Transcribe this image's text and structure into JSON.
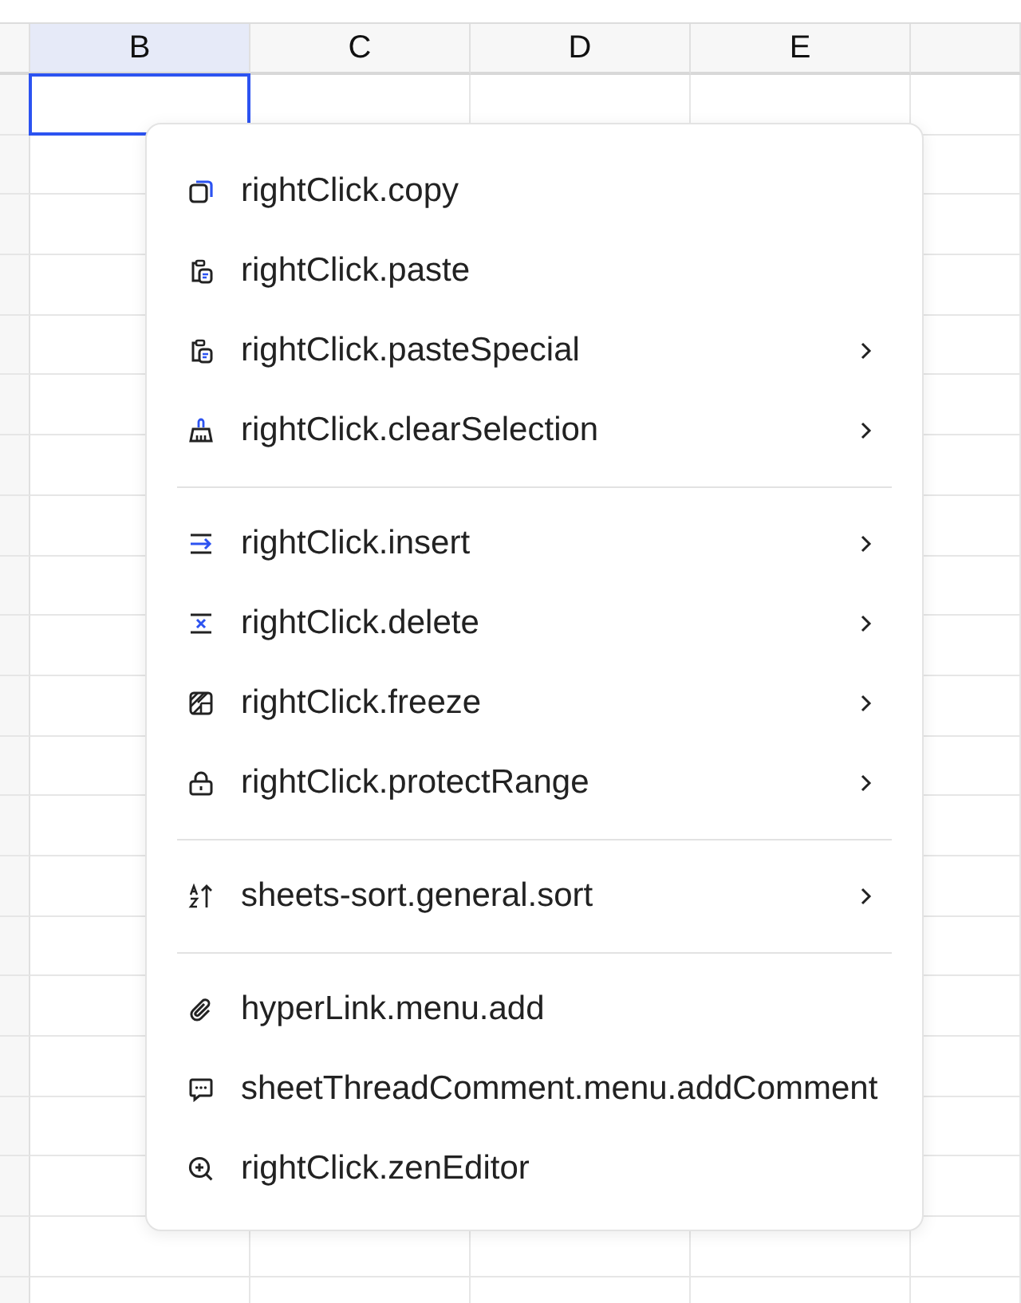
{
  "columns": [
    {
      "label": "B",
      "selected": true
    },
    {
      "label": "C",
      "selected": false
    },
    {
      "label": "D",
      "selected": false
    },
    {
      "label": "E",
      "selected": false
    }
  ],
  "context_menu": {
    "groups": [
      {
        "items": [
          {
            "kind": "copy",
            "label": "rightClick.copy",
            "submenu": false
          },
          {
            "kind": "paste",
            "label": "rightClick.paste",
            "submenu": false
          },
          {
            "kind": "paste",
            "label": "rightClick.pasteSpecial",
            "submenu": true
          },
          {
            "kind": "clear",
            "label": "rightClick.clearSelection",
            "submenu": true
          }
        ]
      },
      {
        "items": [
          {
            "kind": "insert",
            "label": "rightClick.insert",
            "submenu": true
          },
          {
            "kind": "delete",
            "label": "rightClick.delete",
            "submenu": true
          },
          {
            "kind": "freeze",
            "label": "rightClick.freeze",
            "submenu": true
          },
          {
            "kind": "protect",
            "label": "rightClick.protectRange",
            "submenu": true
          }
        ]
      },
      {
        "items": [
          {
            "kind": "sort",
            "label": "sheets-sort.general.sort",
            "submenu": true
          }
        ]
      },
      {
        "items": [
          {
            "kind": "hyperlink",
            "label": "hyperLink.menu.add",
            "submenu": false
          },
          {
            "kind": "comment",
            "label": "sheetThreadComment.menu.addComment",
            "submenu": false
          },
          {
            "kind": "editor",
            "label": "rightClick.zenEditor",
            "submenu": false
          }
        ]
      }
    ]
  }
}
